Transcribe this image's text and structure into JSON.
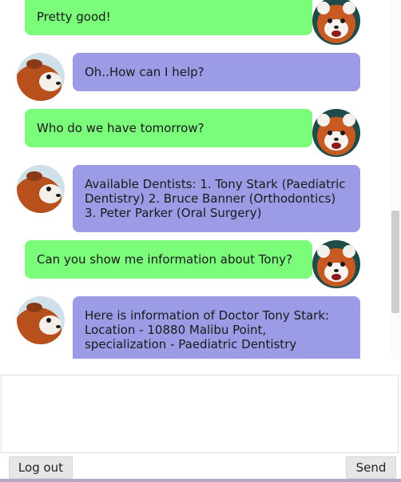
{
  "chat": {
    "messages": [
      {
        "sender": "user",
        "text": "Pretty good!"
      },
      {
        "sender": "bot",
        "text": "Oh..How can I help?"
      },
      {
        "sender": "user",
        "text": "Who do we have tomorrow?"
      },
      {
        "sender": "bot",
        "text": "Available Dentists: 1. Tony Stark (Paediatric Dentistry) 2. Bruce Banner (Orthodontics) 3. Peter Parker (Oral Surgery)"
      },
      {
        "sender": "user",
        "text": "Can you show me information about Tony?"
      },
      {
        "sender": "bot",
        "text": "Here is information of Doctor Tony Stark: Location - 10880 Malibu Point, specialization - Paediatric Dentistry"
      }
    ],
    "user_avatar_icon": "red-panda-face-icon",
    "bot_avatar_icon": "red-panda-side-icon"
  },
  "input": {
    "value": "",
    "placeholder": ""
  },
  "buttons": {
    "logout_label": "Log out",
    "send_label": "Send"
  },
  "colors": {
    "user_bubble": "#7bfc7b",
    "bot_bubble": "#9b9be6",
    "button_bg": "#e6e6e6"
  }
}
